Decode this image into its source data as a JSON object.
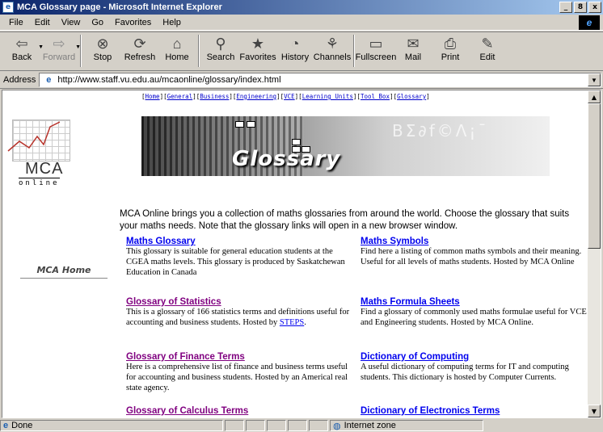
{
  "window": {
    "title": "MCA Glossary page - Microsoft Internet Explorer",
    "buttons": [
      "_",
      "8",
      "x"
    ]
  },
  "menu": [
    "File",
    "Edit",
    "View",
    "Go",
    "Favorites",
    "Help"
  ],
  "toolbar": [
    {
      "label": "Back",
      "icon": "back-arrow-icon",
      "glyph": "⇦"
    },
    {
      "label": "Forward",
      "icon": "forward-arrow-icon",
      "glyph": "⇨"
    },
    {
      "label": "Stop",
      "icon": "stop-icon",
      "glyph": "⊗"
    },
    {
      "label": "Refresh",
      "icon": "refresh-icon",
      "glyph": "⟳"
    },
    {
      "label": "Home",
      "icon": "home-icon",
      "glyph": "⌂"
    },
    {
      "label": "Search",
      "icon": "search-icon",
      "glyph": "⚲"
    },
    {
      "label": "Favorites",
      "icon": "favorites-icon",
      "glyph": "★"
    },
    {
      "label": "History",
      "icon": "history-icon",
      "glyph": "◔"
    },
    {
      "label": "Channels",
      "icon": "channels-icon",
      "glyph": "⚘"
    },
    {
      "label": "Fullscreen",
      "icon": "fullscreen-icon",
      "glyph": "▭"
    },
    {
      "label": "Mail",
      "icon": "mail-icon",
      "glyph": "✉"
    },
    {
      "label": "Print",
      "icon": "print-icon",
      "glyph": "⎙"
    },
    {
      "label": "Edit",
      "icon": "edit-icon",
      "glyph": "✎"
    }
  ],
  "address": {
    "label": "Address",
    "url": "http://www.staff.vu.edu.au/mcaonline/glossary/index.html"
  },
  "page": {
    "topnav": [
      "Home",
      "General",
      "Business",
      "Engineering",
      "VCE",
      "Learning Units",
      "Tool Box",
      "Glossary"
    ],
    "logo": {
      "mca": "MCA",
      "online": "online"
    },
    "banner_title": "Glossary",
    "mca_home": "MCA Home",
    "intro": "MCA Online brings you a collection of maths glossaries from around the world. Choose the glossary that suits your maths needs. Note that the glossary links will open in a new browser window.",
    "entries": [
      {
        "title": "Maths Glossary",
        "desc": "This glossary is suitable for general education students at the CGEA maths levels. This glossary is produced by Saskatchewan Education in Canada",
        "link": ""
      },
      {
        "title": "Maths Symbols",
        "desc": "Find here a listing of common maths symbols and their meaning. Useful for all levels of maths students. Hosted by MCA Online",
        "link": ""
      },
      {
        "title": "Glossary of Statistics",
        "desc": "This is a glossary of 166 statistics terms and definitions useful for accounting and business students. Hosted by",
        "link": "STEPS",
        "after": "."
      },
      {
        "title": "Maths Formula Sheets",
        "desc": "Find a glossary of commonly used maths formulae useful for VCE and Engineering students. Hosted by MCA Online.",
        "link": ""
      },
      {
        "title": "Glossary of Finance Terms",
        "desc": "Here is a comprehensive list of finance and business terms useful for accounting and business students. Hosted by an Americal real state agency.",
        "link": ""
      },
      {
        "title": "Dictionary of Computing",
        "desc": "A useful dictionary of computing terms for IT and computing students. This dictionary is hosted by Computer Currents.",
        "link": ""
      },
      {
        "title": "Glossary of Calculus Terms",
        "desc": "",
        "link": ""
      },
      {
        "title": "Dictionary of Electronics Terms",
        "desc": "",
        "link": ""
      }
    ]
  },
  "status": {
    "text": "Done",
    "zone": "Internet zone"
  }
}
